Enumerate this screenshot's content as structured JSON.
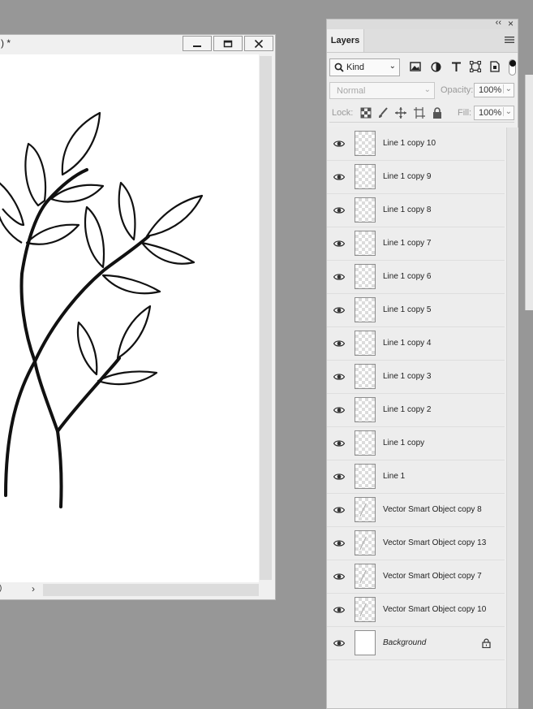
{
  "document": {
    "title": ") *",
    "scroll_left_label": ")",
    "scroll_arrow": "›"
  },
  "panel": {
    "collapse_glyph": "‹‹",
    "close_glyph": "×",
    "tab_label": "Layers",
    "filter": {
      "kind_label": "Kind",
      "icons": [
        "image-filter-icon",
        "adjustment-filter-icon",
        "type-filter-icon",
        "shape-filter-icon",
        "smart-object-filter-icon"
      ]
    },
    "blend_mode": "Normal",
    "opacity_label": "Opacity:",
    "opacity_value": "100%",
    "lock_label": "Lock:",
    "fill_label": "Fill:",
    "fill_value": "100%",
    "layers": [
      {
        "name": "Line 1 copy 10",
        "type": "transparent"
      },
      {
        "name": "Line 1 copy 9",
        "type": "transparent"
      },
      {
        "name": "Line 1 copy 8",
        "type": "transparent"
      },
      {
        "name": "Line 1 copy 7",
        "type": "transparent"
      },
      {
        "name": "Line 1 copy 6",
        "type": "transparent"
      },
      {
        "name": "Line 1 copy 5",
        "type": "transparent"
      },
      {
        "name": "Line 1 copy 4",
        "type": "transparent"
      },
      {
        "name": "Line 1 copy 3",
        "type": "transparent"
      },
      {
        "name": "Line 1 copy 2",
        "type": "transparent"
      },
      {
        "name": "Line 1 copy",
        "type": "transparent"
      },
      {
        "name": "Line 1",
        "type": "transparent"
      },
      {
        "name": "Vector Smart Object copy 8",
        "type": "vector"
      },
      {
        "name": "Vector Smart Object copy 13",
        "type": "vector"
      },
      {
        "name": "Vector Smart Object copy 7",
        "type": "vector"
      },
      {
        "name": "Vector Smart Object copy 10",
        "type": "vector"
      },
      {
        "name": "Background",
        "type": "background",
        "locked": true
      }
    ]
  },
  "colors": {
    "workspace_bg": "#979797",
    "panel_bg": "#eeeeee",
    "canvas_bg": "#ffffff"
  }
}
